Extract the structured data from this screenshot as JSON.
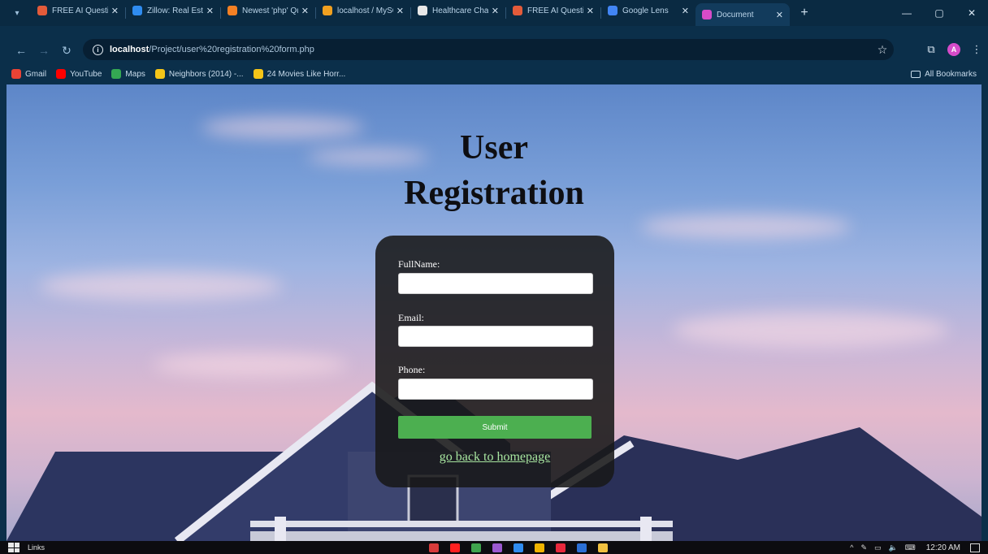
{
  "browser": {
    "tabs": [
      {
        "title": "FREE AI Question",
        "icon": "feather-icon",
        "color": "#e35b3a",
        "active": false
      },
      {
        "title": "Zillow: Real Estat",
        "icon": "zillow-icon",
        "color": "#2f8cf0",
        "active": false
      },
      {
        "title": "Newest 'php' Qu",
        "icon": "stackoverflow-icon",
        "color": "#f48024",
        "active": false
      },
      {
        "title": "localhost / MySQL",
        "icon": "phpmyadmin-icon",
        "color": "#f0a020",
        "active": false
      },
      {
        "title": "Healthcare Chatb",
        "icon": "openai-icon",
        "color": "#e8e8e8",
        "active": false
      },
      {
        "title": "FREE AI Question",
        "icon": "feather-icon",
        "color": "#e35b3a",
        "active": false
      },
      {
        "title": "Google Lens",
        "icon": "google-lens-icon",
        "color": "#4285f4",
        "active": false
      },
      {
        "title": "Document",
        "icon": "document-icon",
        "color": "#d64bc9",
        "active": true
      }
    ],
    "url_host": "localhost",
    "url_path": "/Project/user%20registration%20form.php",
    "profile_initial": "A",
    "bookmarks": [
      {
        "label": "Gmail",
        "icon": "gmail-icon",
        "color": "#ea4335"
      },
      {
        "label": "YouTube",
        "icon": "youtube-icon",
        "color": "#ff0000"
      },
      {
        "label": "Maps",
        "icon": "maps-icon",
        "color": "#34a853"
      },
      {
        "label": "Neighbors (2014) -...",
        "icon": "bookmark-icon",
        "color": "#f5c518"
      },
      {
        "label": "24 Movies Like Horr...",
        "icon": "bookmark-icon",
        "color": "#f5c518"
      }
    ],
    "all_bookmarks": "All Bookmarks"
  },
  "page": {
    "title_line1": "User",
    "title_line2": "Registration",
    "form": {
      "fullname_label": "FullName:",
      "email_label": "Email:",
      "phone_label": "Phone:",
      "submit_label": "Submit",
      "home_link": "go back to homepage"
    }
  },
  "taskbar": {
    "label": "Links",
    "clock": "12:20 AM",
    "apps": [
      {
        "name": "app-red",
        "color": "#d83b3b"
      },
      {
        "name": "app-youtube",
        "color": "#ff2020"
      },
      {
        "name": "app-xbox",
        "color": "#3fa34d"
      },
      {
        "name": "app-purple",
        "color": "#9b59d0"
      },
      {
        "name": "app-vscode",
        "color": "#2f8cf0"
      },
      {
        "name": "app-chrome",
        "color": "#f0b400"
      },
      {
        "name": "app-opera",
        "color": "#e8283c"
      },
      {
        "name": "app-word",
        "color": "#2b6fd6"
      },
      {
        "name": "app-files",
        "color": "#f0c040"
      }
    ]
  }
}
